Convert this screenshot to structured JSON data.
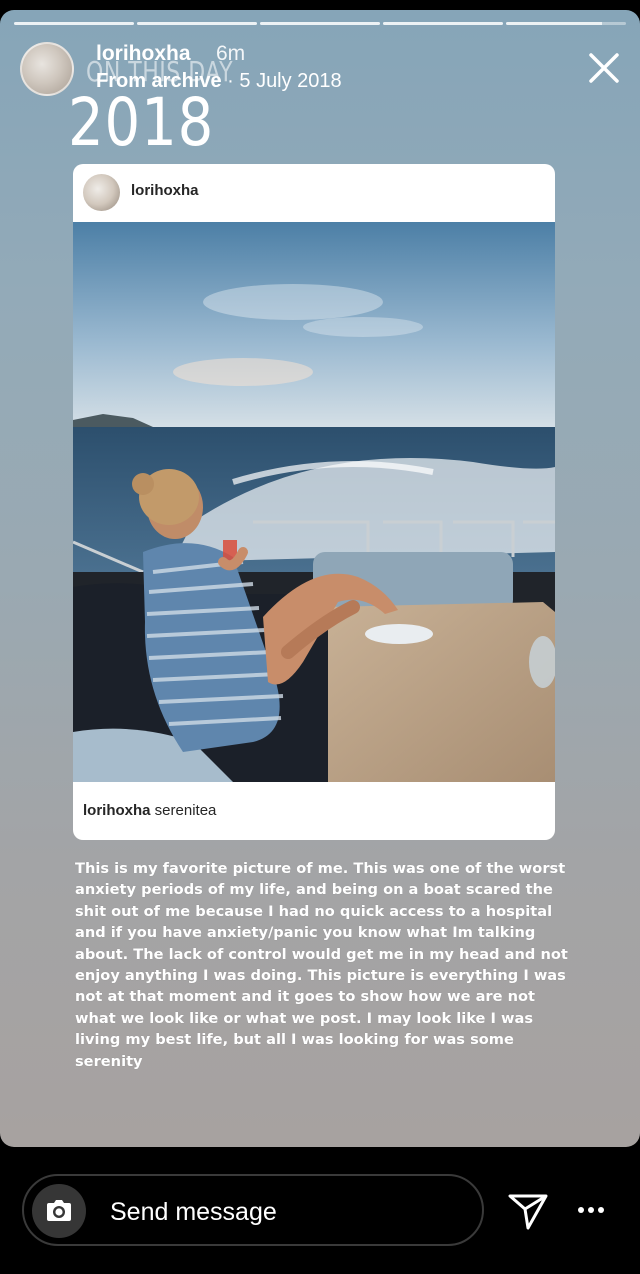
{
  "header": {
    "on_this_day": "ON THIS DAY",
    "year": "2018",
    "username": "lorihoxha",
    "time_ago": "6m",
    "archive_label": "From archive",
    "archive_date": " · 5 July 2018",
    "close_icon": "close-icon"
  },
  "progress": {
    "segments": 5,
    "active_index": 4,
    "active_fraction": 0.8
  },
  "card": {
    "username": "lorihoxha",
    "caption_user": "lorihoxha",
    "caption_text": " serenitea"
  },
  "story_text": "This is my favorite picture of me. This was one of the worst anxiety periods of my life, and being on a boat scared the shit out of me because I had no quick access to a hospital and if you have anxiety/panic you know what Im talking about. The lack of control would get me in my head and not enjoy anything I was doing. This picture is everything I was not at that moment and it goes to show how we are not what we look like or what we post. I may look like I was living my best life, but all I was looking for was some serenity",
  "footer": {
    "message_placeholder": "Send message",
    "camera_icon": "camera-icon",
    "send_icon": "paper-plane-icon",
    "more_icon": "more-dots-icon"
  },
  "colors": {
    "story_top": "#86a5b8",
    "story_bottom": "#a7a2a0",
    "background": "#000000"
  }
}
